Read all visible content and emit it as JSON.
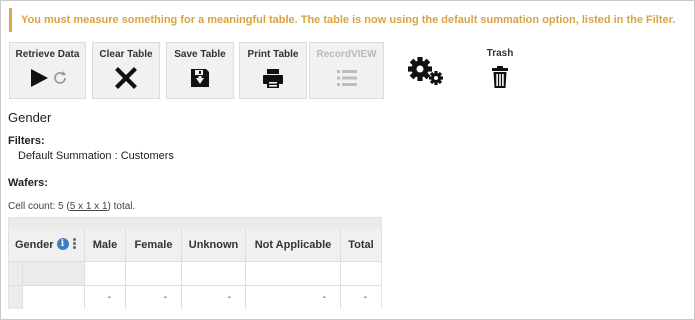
{
  "warning": "You must measure something for a meaningful table. The table is now using the default summation option, listed in the Filter.",
  "toolbar": {
    "retrieve_label": "Retrieve Data",
    "clear_label": "Clear Table",
    "save_label": "Save Table",
    "print_label": "Print Table",
    "recordview_label": "RecordVIEW",
    "trash_label": "Trash"
  },
  "section_title": "Gender",
  "filters": {
    "label": "Filters:",
    "line": "Default Summation : Customers"
  },
  "wafers": {
    "label": "Wafers:"
  },
  "cell_count": {
    "prefix": "Cell count: 5 (",
    "link": "5 x 1 x 1",
    "suffix": ") total."
  },
  "table": {
    "row_header": "Gender",
    "columns": [
      "Male",
      "Female",
      "Unknown",
      "Not Applicable",
      "Total"
    ],
    "rows": [
      [
        "",
        "",
        "",
        "",
        ""
      ],
      [
        "-",
        "-",
        "-",
        "-",
        "-"
      ]
    ]
  }
}
